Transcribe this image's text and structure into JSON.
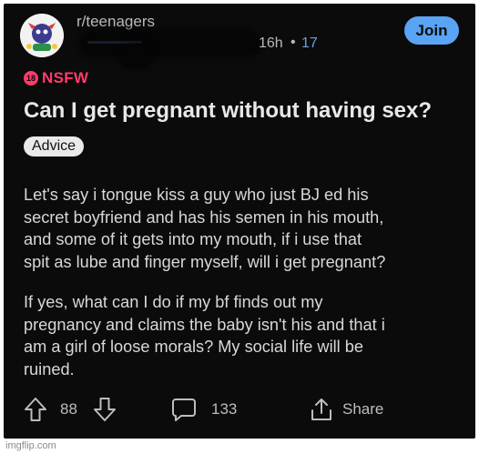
{
  "header": {
    "subreddit": "r/teenagers",
    "time": "16h",
    "separator": "•",
    "count": "17",
    "join_label": "Join"
  },
  "post": {
    "nsfw_badge": "18",
    "nsfw_label": "NSFW",
    "title": "Can I get pregnant without having sex?",
    "flair": "Advice",
    "paragraph1": [
      "Let's say i tongue kiss a guy who just BJ ed his",
      "secret boyfriend and has his semen in his mouth,",
      "and some of it gets into my mouth, if i use that",
      "spit as lube and finger myself, will i get pregnant?"
    ],
    "paragraph2": [
      "If yes, what can I do if my bf finds out my",
      "pregnancy and claims the baby isn't his and that i",
      "am a girl of loose morals? My social life will be",
      "ruined."
    ]
  },
  "actions": {
    "vote_count": "88",
    "comment_count": "133",
    "share_label": "Share"
  },
  "watermark": "imgflip.com",
  "colors": {
    "background": "#0b0b0b",
    "accent_blue": "#5aa4f5",
    "nsfw_pink": "#ff3b6b"
  },
  "icons": {
    "upvote": "arrow-up-icon",
    "downvote": "arrow-down-icon",
    "comments": "speech-bubble-icon",
    "share": "share-icon"
  }
}
